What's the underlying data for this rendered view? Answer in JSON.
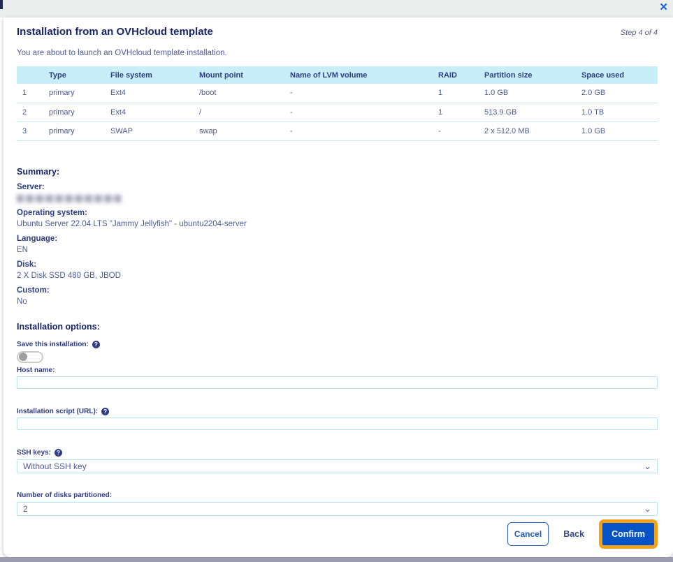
{
  "modal": {
    "title": "Installation from an OVHcloud template",
    "step": "Step 4 of 4",
    "intro": "You are about to launch an OVHcloud template installation."
  },
  "icons": {
    "close": "✕",
    "help": "?",
    "chevron_down": "⌄"
  },
  "table": {
    "headers": [
      "",
      "Type",
      "File system",
      "Mount point",
      "Name of LVM volume",
      "RAID",
      "Partition size",
      "Space used"
    ],
    "rows": [
      [
        "1",
        "primary",
        "Ext4",
        "/boot",
        "-",
        "1",
        "1.0 GB",
        "2.0 GB"
      ],
      [
        "2",
        "primary",
        "Ext4",
        "/",
        "-",
        "1",
        "513.9 GB",
        "1.0 TB"
      ],
      [
        "3",
        "primary",
        "SWAP",
        "swap",
        "-",
        "-",
        "2 x 512.0 MB",
        "1.0 GB"
      ]
    ]
  },
  "summary": {
    "heading": "Summary:",
    "items": [
      {
        "label": "Server:",
        "value": "",
        "redacted": true
      },
      {
        "label": "Operating system:",
        "value": "Ubuntu Server 22.04 LTS \"Jammy Jellyfish\" - ubuntu2204-server"
      },
      {
        "label": "Language:",
        "value": "EN"
      },
      {
        "label": "Disk:",
        "value": "2 X Disk SSD 480 GB, JBOD"
      },
      {
        "label": "Custom:",
        "value": "No"
      }
    ]
  },
  "options": {
    "heading": "Installation options:",
    "save_label": "Save this installation:",
    "save_toggle_state": "off",
    "host_label": "Host name:",
    "host_value": "",
    "script_label": "Installation script (URL):",
    "script_value": "",
    "ssh_label": "SSH keys:",
    "ssh_selected": "Without SSH key",
    "disks_label": "Number of disks partitioned:",
    "disks_selected": "2"
  },
  "footer": {
    "cancel": "Cancel",
    "back": "Back",
    "confirm": "Confirm"
  },
  "colors": {
    "accent_blue": "#0653c6",
    "table_header_bg": "#c8eef8",
    "input_border": "#b3e6f2",
    "focus_ring_orange": "#f6a01a",
    "heading_navy": "#16256b",
    "body_text": "#505b96"
  }
}
